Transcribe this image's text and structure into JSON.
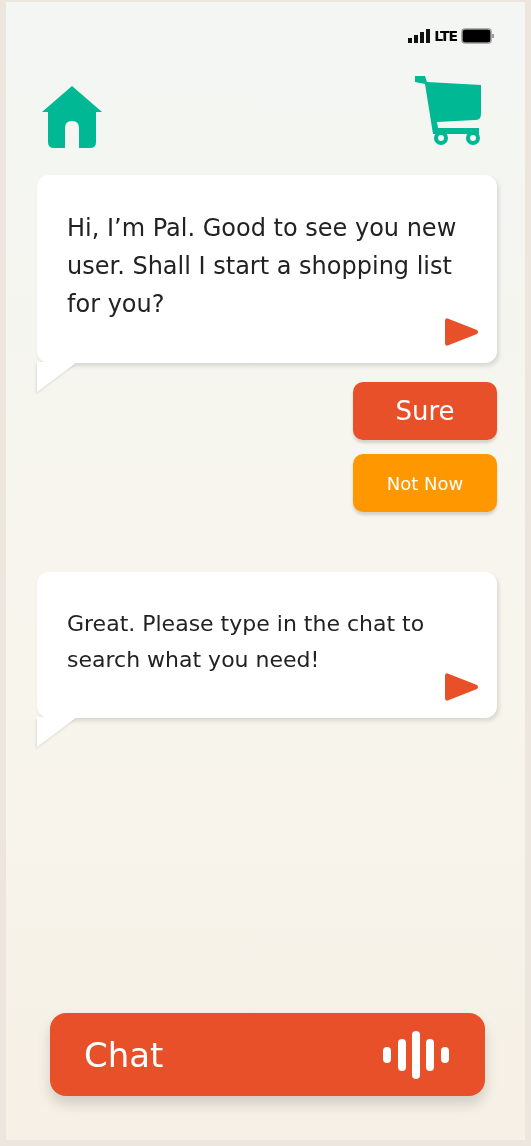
{
  "status_bar": {
    "network": "LTE"
  },
  "messages": [
    {
      "text": "Hi, I’m Pal. Good to see you new user. Shall I start a shopping list for you?",
      "replies": [
        {
          "label": "Sure",
          "kind": "primary"
        },
        {
          "label": "Not Now",
          "kind": "secondary"
        }
      ]
    },
    {
      "text": "Great. Please type in the chat to search what you need!"
    }
  ],
  "chat_button": {
    "label": "Chat"
  }
}
